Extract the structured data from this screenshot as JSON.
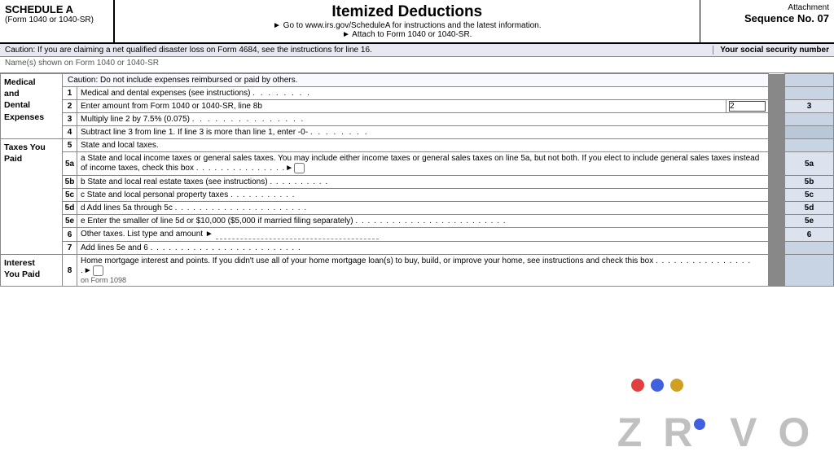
{
  "header": {
    "schedule_label": "SCHEDULE A",
    "form_sub": "(Form 1040 or 1040-SR)",
    "title": "Itemized Deductions",
    "line1": "► Go to www.irs.gov/ScheduleA for instructions and the latest information.",
    "line2": "► Attach to Form 1040 or 1040-SR.",
    "caution": "Caution: If you are claiming a net qualified disaster loss on Form 4684, see the instructions for line 16.",
    "attachment_label": "Attachment",
    "sequence": "Sequence No. 07",
    "ssn_label": "Your social security number"
  },
  "name_row": {
    "label": "Name(s) shown on Form 1040 or 1040-SR"
  },
  "sections": {
    "medical": {
      "label": "Medical\nand\nDental\nExpenses",
      "caution_text": "Caution: Do not include expenses reimbursed or paid by others.",
      "lines": [
        {
          "num": "1",
          "text": "Medical and dental expenses (see instructions)",
          "dots": ". . . . . . . ."
        },
        {
          "num": "2",
          "text": "Enter amount from Form 1040 or 1040-SR, line 8b",
          "field": "2"
        },
        {
          "num": "3",
          "text": "Multiply line 2 by 7.5% (0.075)",
          "dots": ". . . . . . . . . . . . . . ."
        },
        {
          "num": "4",
          "text": "Subtract line 3 from line 1. If line 3 is more than line 1, enter -0-",
          "dots": ". . . . . . . ."
        }
      ]
    },
    "taxes": {
      "label": "Taxes You\nPaid",
      "lines": [
        {
          "num": "5",
          "text": "State and local taxes."
        },
        {
          "num": "5a",
          "text": "a State and local income taxes or general sales taxes. You may include either income taxes or general sales taxes on line 5a, but not both. If you elect to include general sales taxes instead of income taxes, check this box",
          "dots": ". . . . . . . . . . . . . . . ►□"
        },
        {
          "num": "5b",
          "text": "b State and local real estate taxes (see instructions)",
          "dots": ". . . . . . . . . ."
        },
        {
          "num": "5c",
          "text": "c State and local personal property taxes",
          "dots": ". . . . . . . . . . ."
        },
        {
          "num": "5d",
          "text": "d Add lines 5a through 5c",
          "dots": ". . . . . . . . . . . . . . . . . . . . . ."
        },
        {
          "num": "5e",
          "text": "e Enter the smaller of line 5d or $10,000 ($5,000 if married filing separately)",
          "dots": ". . . . . . . . . . . . . . . . . . . . . . . . ."
        },
        {
          "num": "6",
          "text": "Other taxes. List type and amount ►",
          "dots": "- - - - - - - - - - - - - - - - - - - - - - - -"
        },
        {
          "num": "7",
          "text": "Add lines 5e and 6",
          "dots": ". . . . . . . . . . . . . . . . . . . . . . . . ."
        }
      ]
    },
    "interest": {
      "label": "Interest\nYou Paid",
      "lines": [
        {
          "num": "8",
          "text": "Home mortgage interest and points. If you didn't use all of your home mortgage loan(s) to buy, build, or improve your home, see instructions and check this box",
          "dots": ". . . . . . . . . . . . . . . . . ►□"
        }
      ]
    }
  },
  "watermark": {
    "text": "Z R  V O"
  },
  "dots": {
    "red": "#e04040",
    "blue": "#4060e0",
    "gold": "#d0a020"
  }
}
